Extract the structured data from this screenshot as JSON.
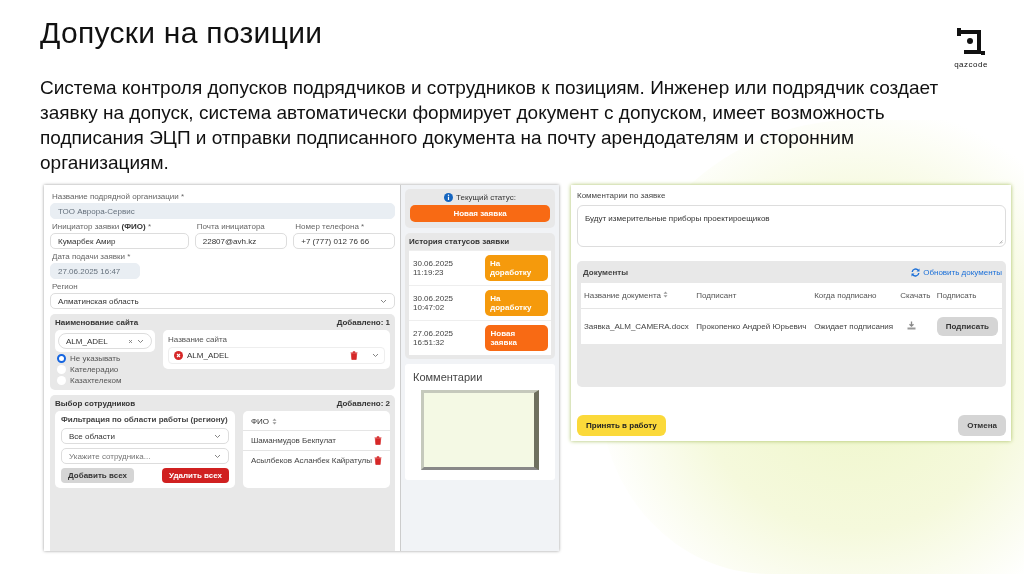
{
  "slide": {
    "title": "Допуски на позиции",
    "description": "Система контроля допусков подрядчиков и сотрудников к позициям. Инженер или подрядчик создает заявку на допуск, система автоматически формирует документ с допуском, имеет возможность подписания ЭЦП и отправки подписанного документа на почту арендодателям и сторонним организациям.",
    "logo_text": "qazcode"
  },
  "application_form": {
    "fields": [
      {
        "kind": "wide",
        "label": "Название подрядной организации *",
        "value": "ТОО Аврора-Сервис",
        "disabled": true
      },
      {
        "kind": "triple",
        "label": "Инициатор заявки **(ФИО)** *",
        "value": "Кумарбек Амир",
        "disabled": false
      },
      {
        "kind": "triple",
        "label": "Почта инициатора",
        "value": "22807@avh.kz",
        "disabled": false
      },
      {
        "kind": "triple",
        "label": "Номер телефона *",
        "value": "+7 (777) 012 76 66",
        "disabled": false
      },
      {
        "kind": "short",
        "label": "Дата подачи заявки *",
        "value": "27.06.2025 16:47",
        "disabled": true
      },
      {
        "kind": "select",
        "label": "Регион",
        "value": "Алматинская область",
        "disabled": false
      }
    ],
    "site_section": {
      "title": "Наименование сайта",
      "added": "Добавлено: 1",
      "select_value": "ALM_ADEL",
      "radios": [
        {
          "label": "Не указывать",
          "selected": true
        },
        {
          "label": "Кателерадио",
          "selected": false
        },
        {
          "label": "Казахтелеком",
          "selected": false
        }
      ],
      "column": "Название сайта",
      "items": [
        "ALM_ADEL"
      ]
    },
    "employees_section": {
      "title": "Выбор сотрудников",
      "added": "Добавлено: 2",
      "filter_label": "Фильтрация по области работы (региону)",
      "region_value": "Все области",
      "employee_placeholder": "Укажите сотрудника...",
      "add_all_button": "Добавить всех",
      "remove_all_button": "Удалить всех",
      "column": "ФИО",
      "employees": [
        "Шаманмудов Бекпулат",
        "Асылбеков Асланбек Кайратулы"
      ]
    }
  },
  "status_panel": {
    "current_label": "Текущий статус:",
    "current_status": "Новая заявка",
    "history_title": "История статусов заявки",
    "history": [
      {
        "date": "30.06.2025 11:19:23",
        "status": "На доработку",
        "kind": "rework"
      },
      {
        "date": "30.06.2025 10:47:02",
        "status": "На доработку",
        "kind": "rework"
      },
      {
        "date": "27.06.2025 16:51:32",
        "status": "Новая заявка",
        "kind": "new"
      }
    ]
  },
  "comments_panel": {
    "title": "Комментарии"
  },
  "request_details": {
    "comment_label": "Комментарии по заявке",
    "comment_value": "Будут измерительные приборы проектироещиков",
    "documents_title": "Документы",
    "refresh_link": "Обновить документы",
    "columns": [
      "Название документа",
      "Подписант",
      "Когда подписано",
      "Скачать",
      "Подписать"
    ],
    "rows": [
      {
        "document": "Заявка_ALM_CAMERA.docx",
        "signer": "Прокопенко Андрей Юрьевич",
        "signed": "Ожидает подписания",
        "sign_button": "Подписать"
      }
    ],
    "accept_button": "Принять в работу",
    "cancel_button": "Отмена"
  }
}
